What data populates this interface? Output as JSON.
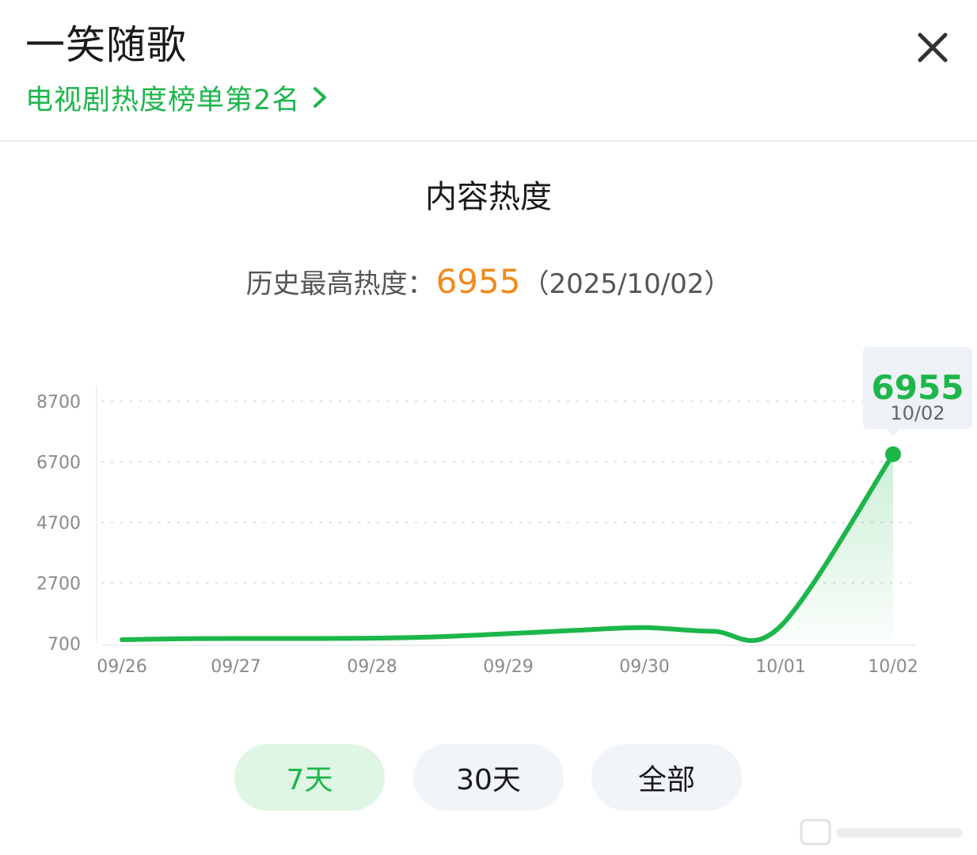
{
  "header": {
    "title": "一笑随歌",
    "rank_label": "电视剧热度榜单第2名"
  },
  "section": {
    "title": "内容热度"
  },
  "record": {
    "label": "历史最高热度：",
    "value": "6955",
    "date": "（2025/10/02）"
  },
  "tooltip": {
    "value": "6955",
    "date": "10/02"
  },
  "tabs": [
    {
      "label": "7天",
      "active": true
    },
    {
      "label": "30天",
      "active": false
    },
    {
      "label": "全部",
      "active": false
    }
  ],
  "colors": {
    "accent": "#1cb64a",
    "record_value": "#f28a1a",
    "tab_active_bg": "#dff6e4",
    "tab_bg": "#f1f4f8"
  },
  "icons": {
    "close": "close-icon",
    "chevron": "chevron-right-icon"
  },
  "chart_data": {
    "type": "area",
    "categories": [
      "09/26",
      "09/27",
      "09/28",
      "09/29",
      "09/30",
      "10/01",
      "10/02"
    ],
    "yticks": [
      700,
      2700,
      4700,
      6700,
      8700
    ],
    "ylim": [
      700,
      8700
    ],
    "grid": true,
    "series": [
      {
        "x": [
          0,
          0.5,
          1,
          1.5,
          2,
          2.5,
          3,
          3.5,
          4,
          4.5,
          5,
          6
        ],
        "values": [
          830,
          860,
          870,
          870,
          880,
          930,
          1030,
          1140,
          1230,
          1110,
          1280,
          6955
        ]
      }
    ],
    "highlight": {
      "category": "10/02",
      "value": 6955
    }
  }
}
